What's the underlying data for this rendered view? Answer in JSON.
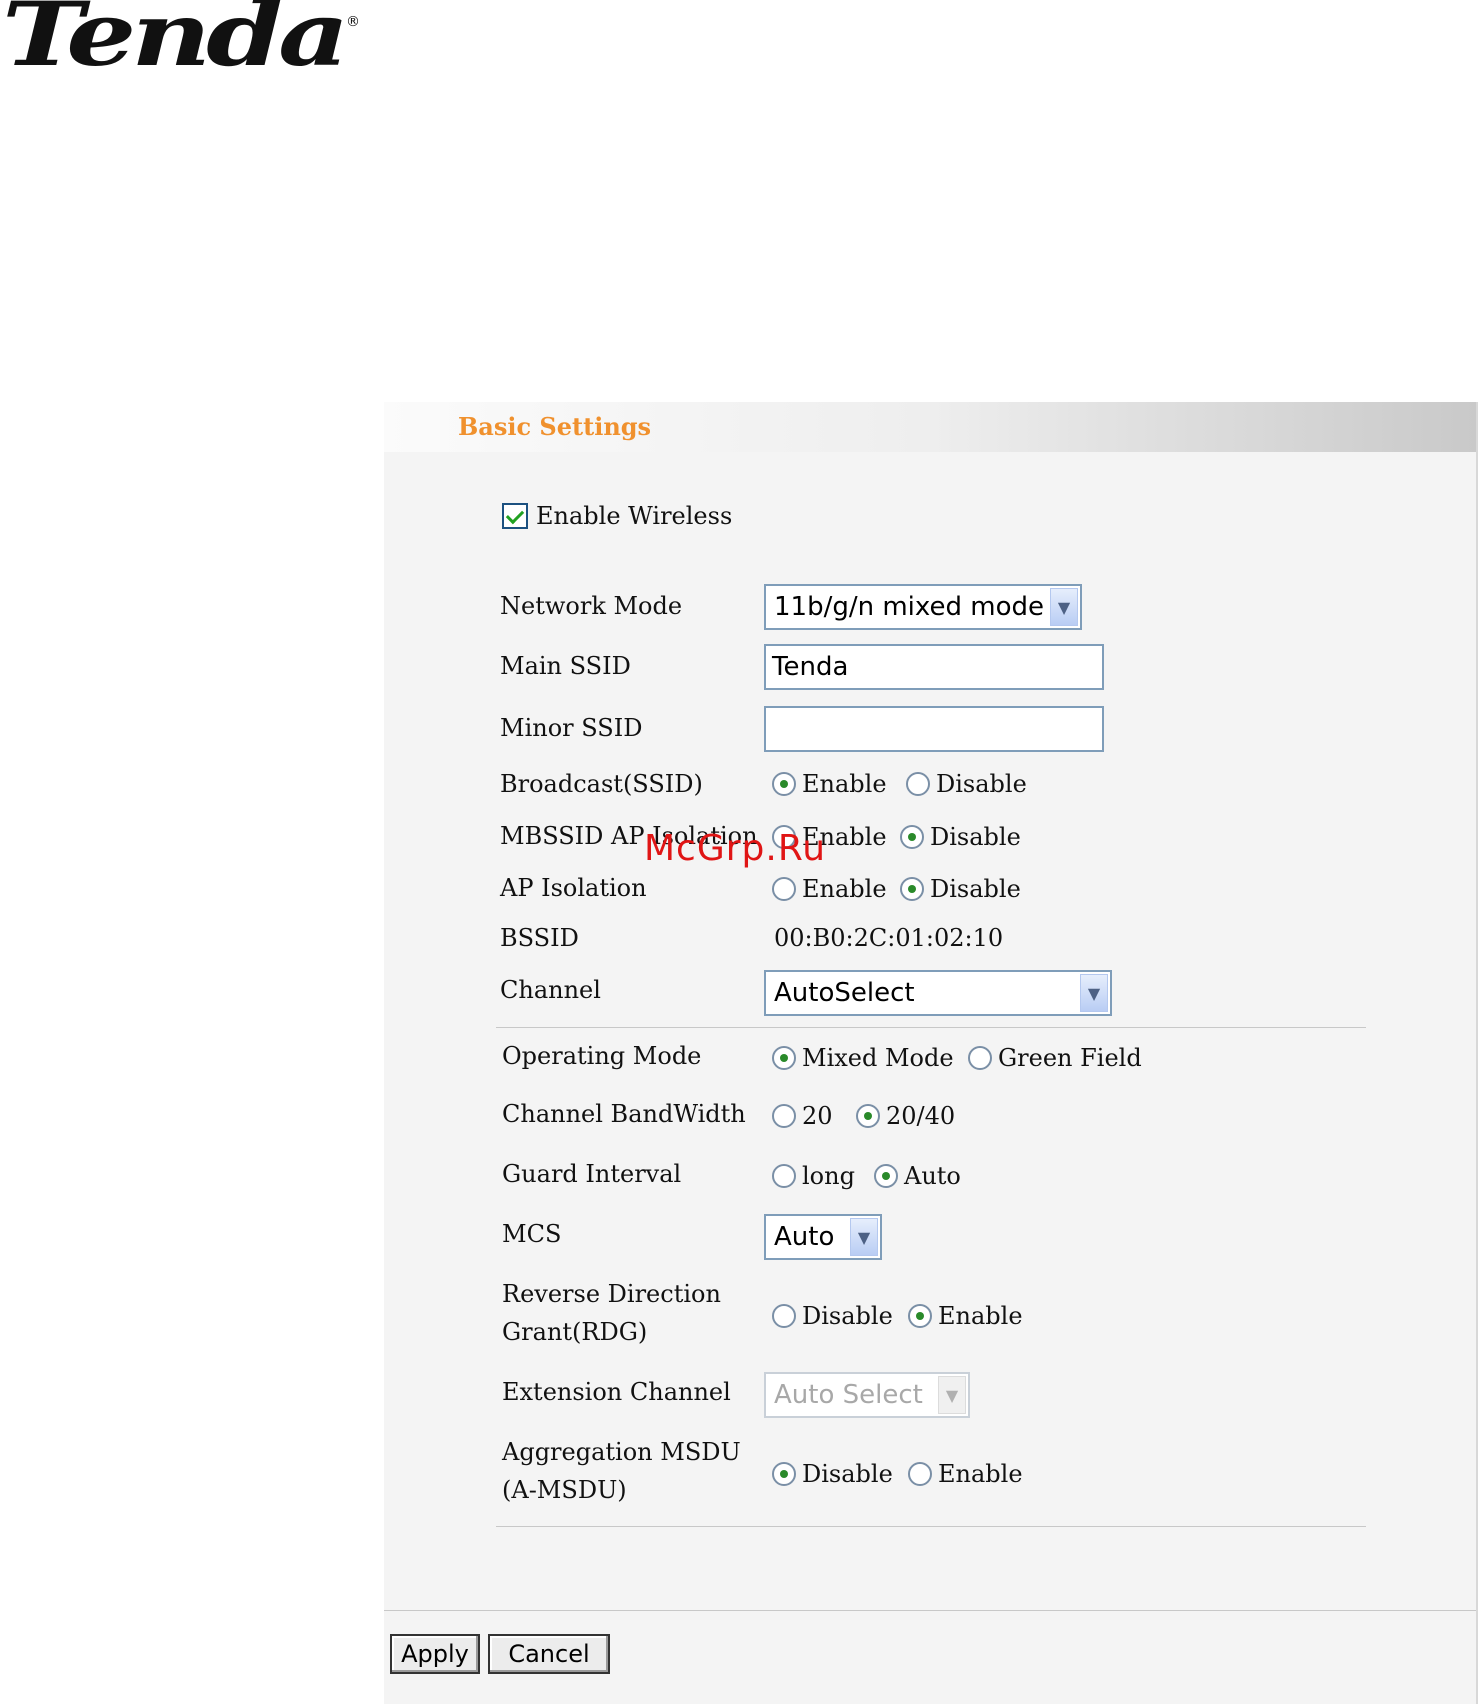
{
  "brand": {
    "logo_text": "Tenda",
    "registered_mark": "®"
  },
  "panel": {
    "title": "Basic Settings"
  },
  "enable_wireless": {
    "label": "Enable Wireless",
    "checked": true
  },
  "network_mode": {
    "label": "Network Mode",
    "value": "11b/g/n mixed mode"
  },
  "main_ssid": {
    "label": "Main SSID",
    "value": "Tenda"
  },
  "minor_ssid": {
    "label": "Minor SSID",
    "value": ""
  },
  "broadcast_ssid": {
    "label": "Broadcast(SSID)",
    "options": [
      "Enable",
      "Disable"
    ],
    "selected": "Enable"
  },
  "mbssid_ap_isolation": {
    "label": "MBSSID AP Isolation",
    "options": [
      "Enable",
      "Disable"
    ],
    "selected": "Disable"
  },
  "ap_isolation": {
    "label": "AP Isolation",
    "options": [
      "Enable",
      "Disable"
    ],
    "selected": "Disable"
  },
  "bssid": {
    "label": "BSSID",
    "value": "00:B0:2C:01:02:10"
  },
  "channel": {
    "label": "Channel",
    "value": "AutoSelect"
  },
  "operating_mode": {
    "label": "Operating Mode",
    "options": [
      "Mixed Mode",
      "Green Field"
    ],
    "selected": "Mixed Mode"
  },
  "channel_bandwidth": {
    "label": "Channel BandWidth",
    "options": [
      "20",
      "20/40"
    ],
    "selected": "20/40"
  },
  "guard_interval": {
    "label": "Guard Interval",
    "options": [
      "long",
      "Auto"
    ],
    "selected": "Auto"
  },
  "mcs": {
    "label": "MCS",
    "value": "Auto"
  },
  "rdg": {
    "label_line1": "Reverse Direction",
    "label_line2": "Grant(RDG)",
    "options": [
      "Disable",
      "Enable"
    ],
    "selected": "Enable"
  },
  "extension_channel": {
    "label": "Extension Channel",
    "value": "Auto Select",
    "disabled": true
  },
  "amsdu": {
    "label_line1": "Aggregation MSDU",
    "label_line2": "(A-MSDU)",
    "options": [
      "Disable",
      "Enable"
    ],
    "selected": "Disable"
  },
  "buttons": {
    "apply": "Apply",
    "cancel": "Cancel"
  },
  "watermark": "McGrp.Ru"
}
